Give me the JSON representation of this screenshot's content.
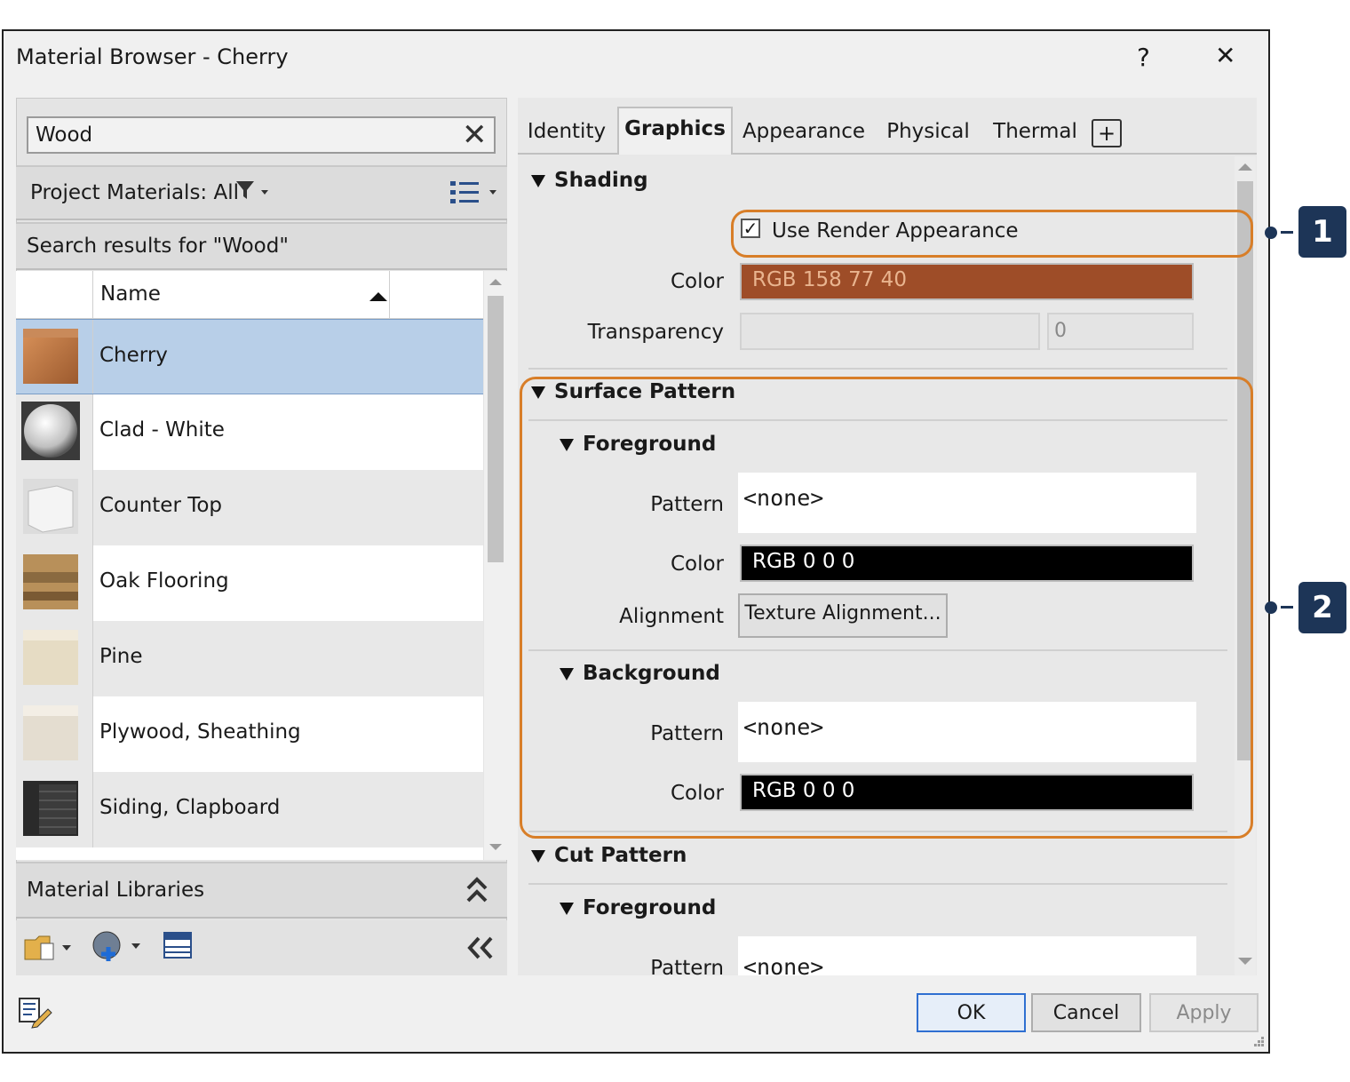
{
  "window": {
    "title": "Material Browser - Cherry",
    "help": "?",
    "close": "✕"
  },
  "search": {
    "value": "Wood",
    "clear": "✕"
  },
  "filter": {
    "label": "Project Materials: All"
  },
  "results_caption": "Search results for \"Wood\"",
  "list": {
    "column": "Name",
    "items": [
      {
        "name": "Cherry",
        "selected": true
      },
      {
        "name": "Clad - White"
      },
      {
        "name": "Counter Top"
      },
      {
        "name": "Oak Flooring"
      },
      {
        "name": "Pine"
      },
      {
        "name": "Plywood, Sheathing"
      },
      {
        "name": "Siding, Clapboard"
      }
    ]
  },
  "libraries": {
    "label": "Material Libraries"
  },
  "tabs": [
    "Identity",
    "Graphics",
    "Appearance",
    "Physical",
    "Thermal",
    "+"
  ],
  "active_tab": "Graphics",
  "shading": {
    "title": "Shading",
    "use_render_label": "Use Render Appearance",
    "color_label": "Color",
    "color_value": "RGB 158 77 40",
    "transparency_label": "Transparency",
    "transparency_value": "0"
  },
  "surface": {
    "title": "Surface Pattern",
    "foreground": {
      "title": "Foreground",
      "pattern_label": "Pattern",
      "pattern_value": "<none>",
      "color_label": "Color",
      "color_value": "RGB 0 0 0",
      "alignment_label": "Alignment",
      "alignment_button": "Texture Alignment..."
    },
    "background": {
      "title": "Background",
      "pattern_label": "Pattern",
      "pattern_value": "<none>",
      "color_label": "Color",
      "color_value": "RGB 0 0 0"
    }
  },
  "cut": {
    "title": "Cut Pattern",
    "foreground": {
      "title": "Foreground",
      "pattern_label": "Pattern",
      "pattern_value": "<none>"
    }
  },
  "buttons": {
    "ok": "OK",
    "cancel": "Cancel",
    "apply": "Apply"
  },
  "callouts": [
    "1",
    "2"
  ],
  "colors": {
    "shading": "#9e4d28",
    "callout": "#d87e28",
    "badge": "#1d3557",
    "selected_row": "#b8cfe8"
  }
}
